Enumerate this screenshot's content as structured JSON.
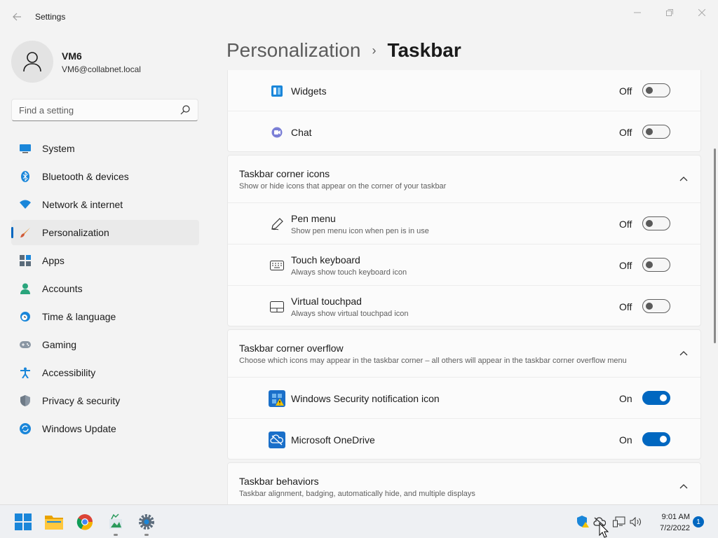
{
  "window": {
    "title": "Settings",
    "back_icon": "arrow-left-icon",
    "min_icon": "minimize-icon",
    "max_icon": "maximize-icon",
    "close_icon": "close-icon"
  },
  "profile": {
    "name": "VM6",
    "email": "VM6@collabnet.local"
  },
  "search": {
    "placeholder": "Find a setting",
    "value": ""
  },
  "sidebar": {
    "items": [
      {
        "label": "System",
        "icon": "monitor-icon",
        "active": false
      },
      {
        "label": "Bluetooth & devices",
        "icon": "bluetooth-icon",
        "active": false
      },
      {
        "label": "Network & internet",
        "icon": "wifi-icon",
        "active": false
      },
      {
        "label": "Personalization",
        "icon": "paintbrush-icon",
        "active": true
      },
      {
        "label": "Apps",
        "icon": "apps-icon",
        "active": false
      },
      {
        "label": "Accounts",
        "icon": "person-icon",
        "active": false
      },
      {
        "label": "Time & language",
        "icon": "globe-clock-icon",
        "active": false
      },
      {
        "label": "Gaming",
        "icon": "gamepad-icon",
        "active": false
      },
      {
        "label": "Accessibility",
        "icon": "accessibility-icon",
        "active": false
      },
      {
        "label": "Privacy & security",
        "icon": "shield-icon",
        "active": false
      },
      {
        "label": "Windows Update",
        "icon": "update-icon",
        "active": false
      }
    ]
  },
  "breadcrumb": {
    "parent": "Personalization",
    "separator": "›",
    "current": "Taskbar"
  },
  "taskbar_items": {
    "rows": [
      {
        "title": "Widgets",
        "icon": "widgets-icon",
        "state": "Off",
        "on": false
      },
      {
        "title": "Chat",
        "icon": "chat-icon",
        "state": "Off",
        "on": false
      }
    ]
  },
  "corner_icons": {
    "title": "Taskbar corner icons",
    "description": "Show or hide icons that appear on the corner of your taskbar",
    "rows": [
      {
        "title": "Pen menu",
        "desc": "Show pen menu icon when pen is in use",
        "icon": "pen-icon",
        "state": "Off",
        "on": false
      },
      {
        "title": "Touch keyboard",
        "desc": "Always show touch keyboard icon",
        "icon": "keyboard-icon",
        "state": "Off",
        "on": false
      },
      {
        "title": "Virtual touchpad",
        "desc": "Always show virtual touchpad icon",
        "icon": "touchpad-icon",
        "state": "Off",
        "on": false
      }
    ]
  },
  "corner_overflow": {
    "title": "Taskbar corner overflow",
    "description": "Choose which icons may appear in the taskbar corner – all others will appear in the taskbar corner overflow menu",
    "rows": [
      {
        "title": "Windows Security notification icon",
        "icon": "windows-security-icon",
        "state": "On",
        "on": true
      },
      {
        "title": "Microsoft OneDrive",
        "icon": "onedrive-icon",
        "state": "On",
        "on": true
      }
    ]
  },
  "behaviors": {
    "title": "Taskbar behaviors",
    "description": "Taskbar alignment, badging, automatically hide, and multiple displays"
  },
  "taskbar": {
    "apps": [
      "start-icon",
      "file-explorer-icon",
      "chrome-icon",
      "app-icon",
      "settings-icon"
    ],
    "tray": [
      "security-shield-icon",
      "onedrive-tray-icon",
      "network-icon",
      "volume-icon"
    ],
    "time": "9:01 AM",
    "date": "7/2/2022",
    "notification_count": "1"
  },
  "colors": {
    "accent": "#0067c0",
    "background": "#f3f3f3",
    "card": "#fbfbfb"
  }
}
